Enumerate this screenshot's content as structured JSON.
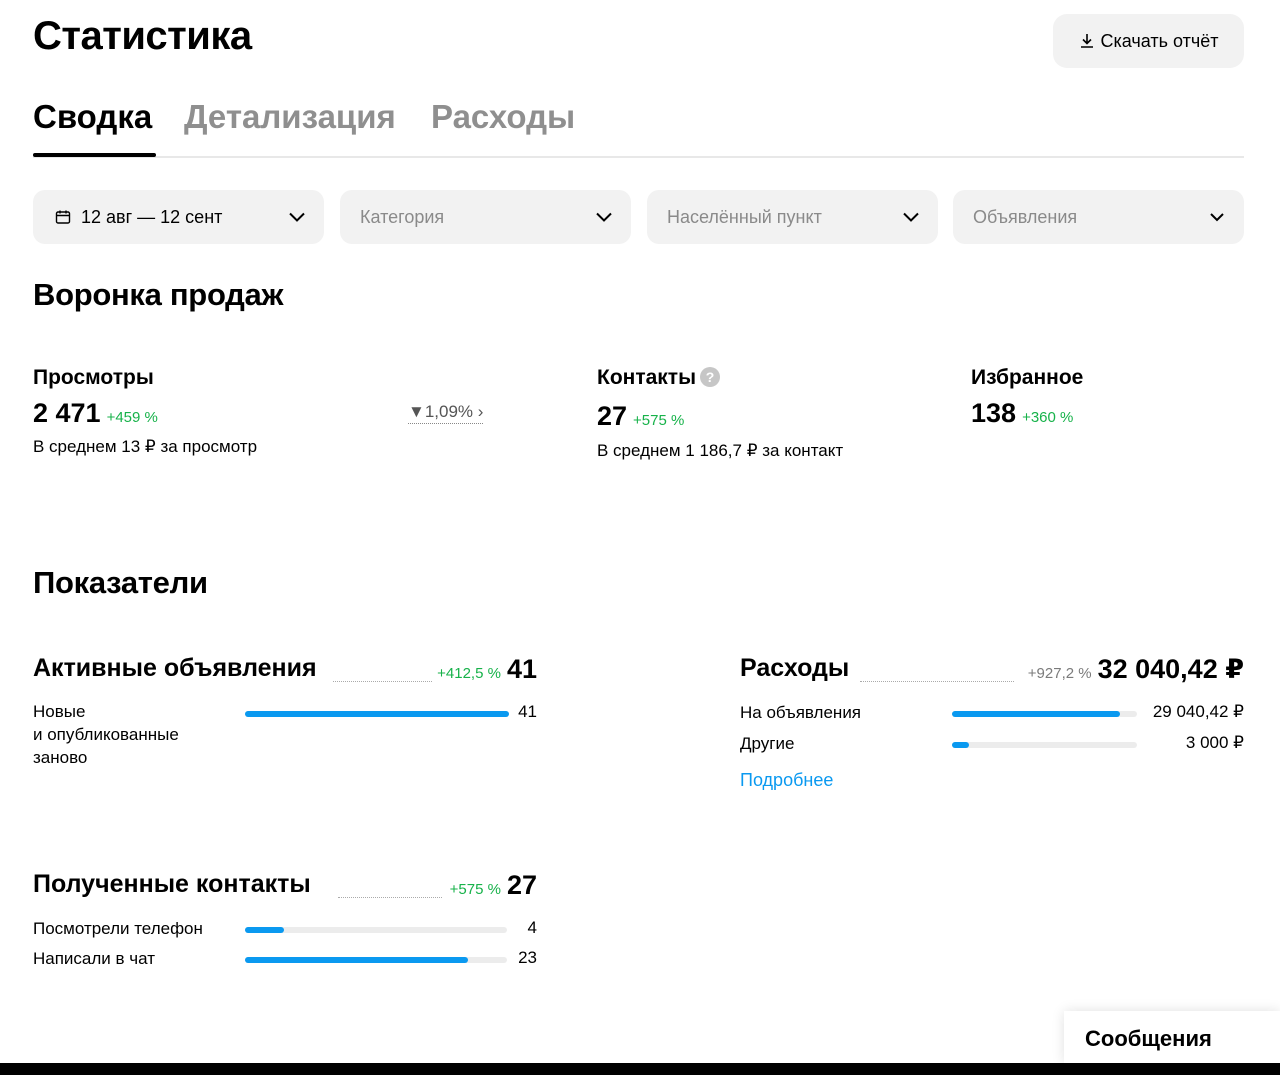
{
  "header": {
    "title": "Статистика",
    "download_label": "Скачать отчёт"
  },
  "tabs": [
    {
      "label": "Сводка",
      "active": true
    },
    {
      "label": "Детализация",
      "active": false
    },
    {
      "label": "Расходы",
      "active": false
    }
  ],
  "filters": {
    "period": "12 авг — 12 сент",
    "category_placeholder": "Категория",
    "city_placeholder": "Населённый пункт",
    "ads_placeholder": "Объявления"
  },
  "funnel": {
    "title": "Воронка продаж",
    "views": {
      "label": "Просмотры",
      "value": "2 471",
      "delta": "+459 %",
      "sub": "В среднем 13 ₽ за просмотр"
    },
    "conversion": "1,09%",
    "contacts": {
      "label": "Контакты",
      "value": "27",
      "delta": "+575 %",
      "sub": "В среднем 1 186,7 ₽ за контакт",
      "help": "?"
    },
    "favorites": {
      "label": "Избранное",
      "value": "138",
      "delta": "+360 %"
    }
  },
  "indicators": {
    "title": "Показатели",
    "active_ads": {
      "title": "Активные объявления",
      "delta": "+412,5 %",
      "total": "41",
      "rows": [
        {
          "label": "Новые\nи опубликованные\nзаново",
          "value": "41",
          "fraction": 1.0
        }
      ]
    },
    "expenses": {
      "title": "Расходы",
      "delta": "+927,2 %",
      "total": "32 040,42 ₽",
      "rows": [
        {
          "label": "На объявления",
          "value": "29 040,42 ₽",
          "fraction": 0.906
        },
        {
          "label": "Другие",
          "value": "3 000 ₽",
          "fraction": 0.094
        }
      ],
      "more_label": "Подробнее"
    },
    "contacts_received": {
      "title": "Полученные контакты",
      "delta": "+575 %",
      "total": "27",
      "rows": [
        {
          "label": "Посмотрели телефон",
          "value": "4",
          "fraction": 0.148
        },
        {
          "label": "Написали в чат",
          "value": "23",
          "fraction": 0.852
        }
      ]
    }
  },
  "messages_label": "Сообщения",
  "colors": {
    "accent": "#0a99f0",
    "positive": "#17b24a",
    "muted": "#8f8f8f",
    "chip_bg": "#f2f2f2"
  }
}
